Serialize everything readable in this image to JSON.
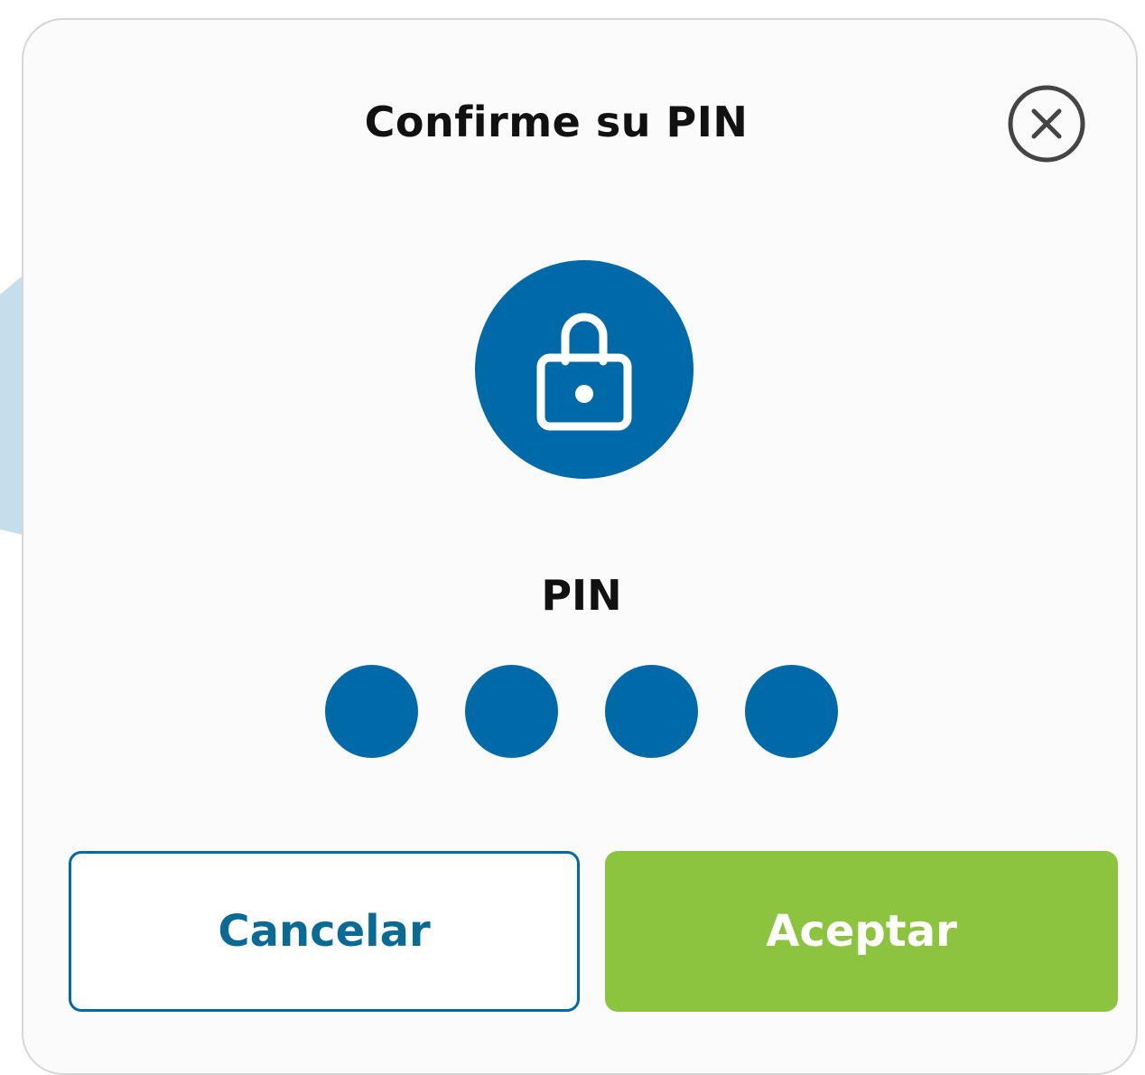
{
  "dialog": {
    "title": "Confirme su PIN",
    "close_icon": "close-circle-icon",
    "lock_icon": "lock-icon",
    "pin_label": "PIN",
    "pin_digits_entered": 4,
    "buttons": {
      "cancel_label": "Cancelar",
      "accept_label": "Aceptar"
    }
  },
  "colors": {
    "primary_blue": "#0069a8",
    "accept_green": "#8cc43f",
    "backdrop_accent": "#c4dfeb"
  }
}
